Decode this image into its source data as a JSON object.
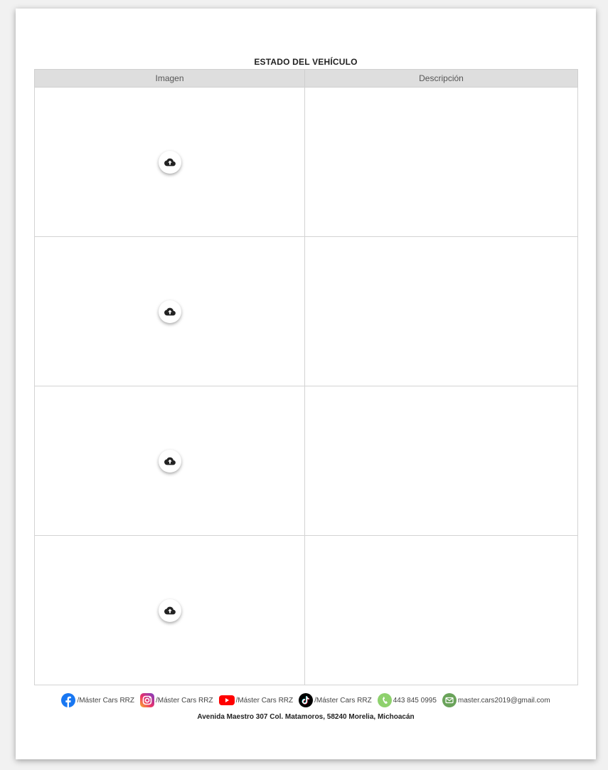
{
  "section": {
    "title": "ESTADO DEL VEHÍCULO",
    "columns": [
      "Imagen",
      "Descripción"
    ],
    "rows": [
      {
        "image_icon": "cloud-upload-icon",
        "description": ""
      },
      {
        "image_icon": "cloud-upload-icon",
        "description": ""
      },
      {
        "image_icon": "cloud-upload-icon",
        "description": ""
      },
      {
        "image_icon": "cloud-upload-icon",
        "description": ""
      }
    ]
  },
  "footer": {
    "facebook": "/Máster Cars RRZ",
    "instagram": "/Máster Cars RRZ",
    "youtube": "/Máster Cars RRZ",
    "tiktok": "/Máster Cars RRZ",
    "phone": "443 845 0995",
    "email": "master.cars2019@gmail.com",
    "address": "Avenida Maestro 307 Col. Matamoros, 58240 Morelia, Michoacán"
  },
  "colors": {
    "header_bg": "#dedede",
    "facebook": "#1877f2",
    "youtube": "#ff0000",
    "tiktok": "#000000",
    "phone": "#8ed16d",
    "email": "#6aa35a"
  }
}
